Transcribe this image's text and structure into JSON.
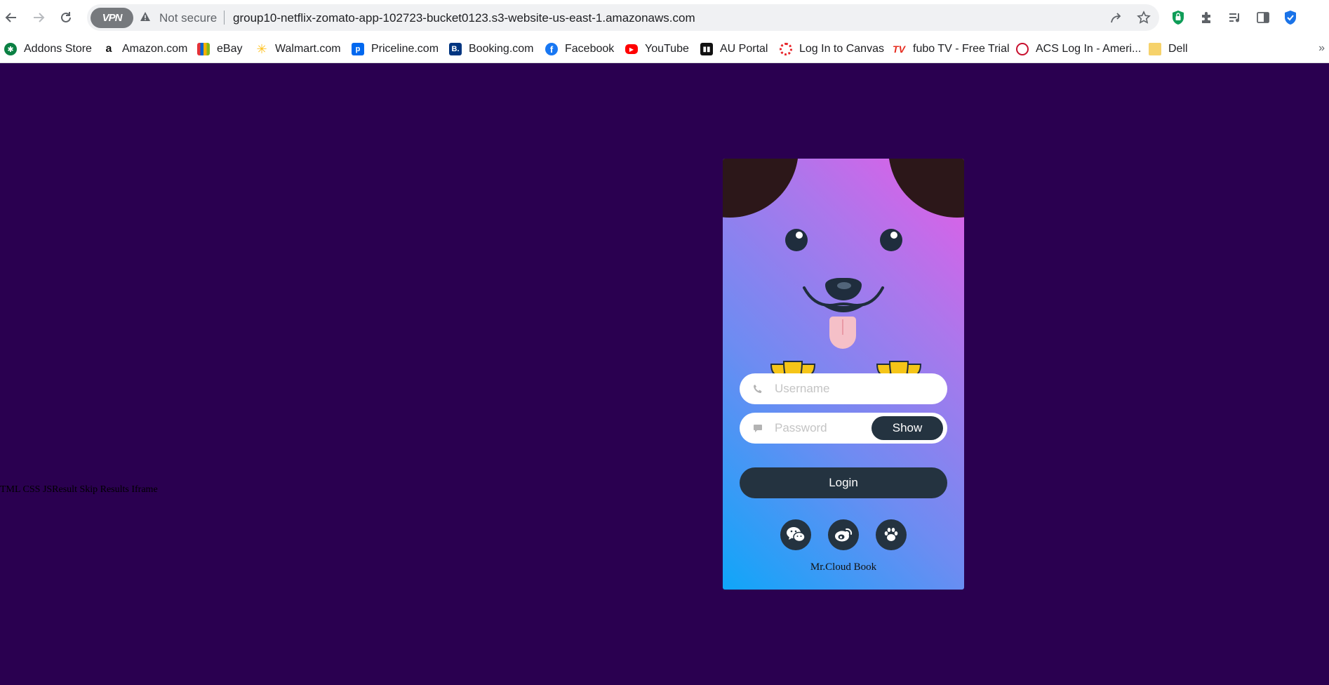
{
  "browser": {
    "address_bar": {
      "vpn_label": "VPN",
      "security_label": "Not secure",
      "url": "group10-netflix-zomato-app-102723-bucket0123.s3-website-us-east-1.amazonaws.com"
    },
    "bookmarks": [
      {
        "label": "Addons Store",
        "icon": "addons-store-icon"
      },
      {
        "label": "Amazon.com",
        "icon": "amazon-icon"
      },
      {
        "label": "eBay",
        "icon": "ebay-icon"
      },
      {
        "label": "Walmart.com",
        "icon": "walmart-icon"
      },
      {
        "label": "Priceline.com",
        "icon": "priceline-icon"
      },
      {
        "label": "Booking.com",
        "icon": "booking-icon"
      },
      {
        "label": "Facebook",
        "icon": "facebook-icon"
      },
      {
        "label": "YouTube",
        "icon": "youtube-icon"
      },
      {
        "label": "AU Portal",
        "icon": "au-portal-icon"
      },
      {
        "label": "Log In to Canvas",
        "icon": "canvas-icon"
      },
      {
        "label": "fubo TV - Free Trial",
        "icon": "fubo-icon"
      },
      {
        "label": "ACS Log In - Ameri...",
        "icon": "acs-icon"
      },
      {
        "label": "Dell",
        "icon": "folder-icon"
      }
    ]
  },
  "page": {
    "background": "#2a0050",
    "stray_text": "TML CSS JSResult Skip Results Iframe"
  },
  "login_card": {
    "gradient": [
      "#e65ce6",
      "#a978ec",
      "#6d8cf2",
      "#0fa6f9"
    ],
    "username_placeholder": "Username",
    "password_placeholder": "Password",
    "show_label": "Show",
    "login_label": "Login",
    "social_icons": [
      "wechat-icon",
      "weibo-icon",
      "paw-icon"
    ],
    "brand": "Mr.Cloud Book"
  }
}
